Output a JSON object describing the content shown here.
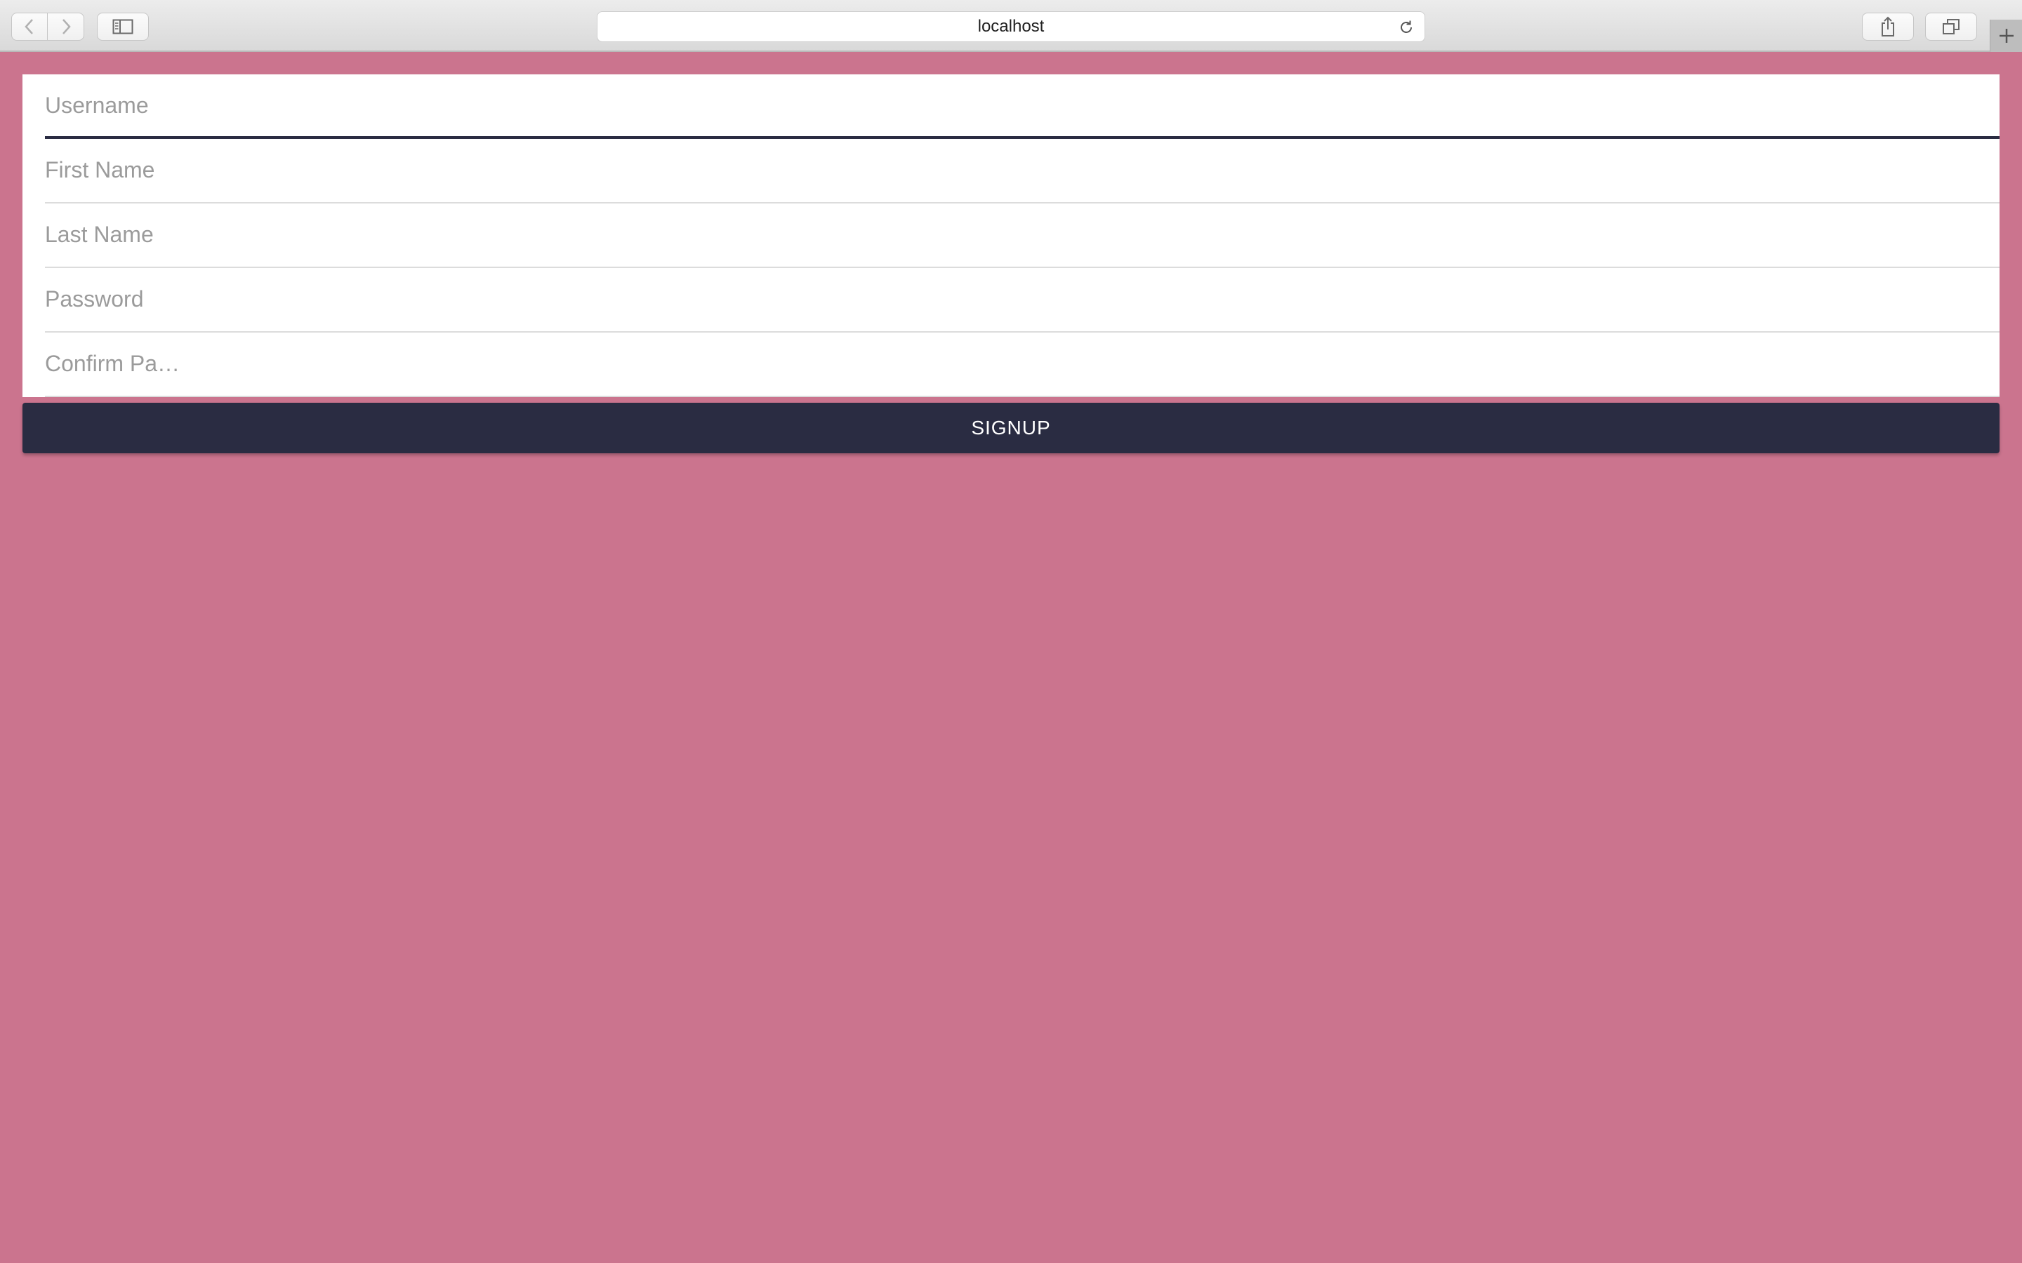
{
  "browser": {
    "url": "localhost",
    "icons": {
      "back": "chevron-left-icon",
      "forward": "chevron-right-icon",
      "sidebar": "sidebar-icon",
      "reload": "reload-icon",
      "share": "share-icon",
      "tabs": "tabs-overview-icon",
      "new_tab": "plus-icon"
    }
  },
  "form": {
    "fields": [
      {
        "placeholder": "Username",
        "value": ""
      },
      {
        "placeholder": "First Name",
        "value": ""
      },
      {
        "placeholder": "Last Name",
        "value": ""
      },
      {
        "placeholder": "Password",
        "value": ""
      },
      {
        "placeholder": "Confirm Pa…",
        "value": ""
      }
    ],
    "submit_label": "SIGNUP"
  },
  "colors": {
    "page_background": "#cb748e",
    "button_background": "#2a2c42",
    "button_text": "#ffffff",
    "placeholder_text": "#9b9b9b"
  }
}
